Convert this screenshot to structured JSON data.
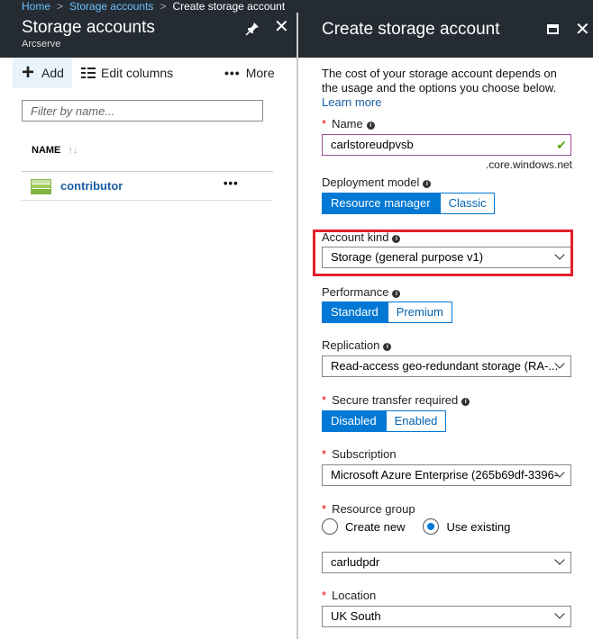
{
  "breadcrumb": {
    "items": [
      "Home",
      "Storage accounts"
    ],
    "current": "Create storage account"
  },
  "left_blade": {
    "title": "Storage accounts",
    "subtitle": "Arcserve",
    "toolbar": {
      "add": "Add",
      "edit_columns": "Edit columns",
      "more": "More"
    },
    "filter_placeholder": "Filter by name...",
    "column_name": "NAME",
    "rows": [
      {
        "name": "contributor"
      }
    ]
  },
  "right_blade": {
    "title": "Create storage account",
    "intro": "The cost of your storage account depends on the usage and the options you choose below.",
    "learn_more": "Learn more",
    "name": {
      "label": "Name",
      "value": "carlstoreudpvsb",
      "suffix": ".core.windows.net"
    },
    "deployment_model": {
      "label": "Deployment model",
      "options": [
        "Resource manager",
        "Classic"
      ],
      "selected": "Resource manager"
    },
    "account_kind": {
      "label": "Account kind",
      "value": "Storage (general purpose v1)"
    },
    "performance": {
      "label": "Performance",
      "options": [
        "Standard",
        "Premium"
      ],
      "selected": "Standard"
    },
    "replication": {
      "label": "Replication",
      "value": "Read-access geo-redundant storage (RA-..."
    },
    "secure_transfer": {
      "label": "Secure transfer required",
      "options": [
        "Disabled",
        "Enabled"
      ],
      "selected": "Disabled"
    },
    "subscription": {
      "label": "Subscription",
      "value": "Microsoft Azure Enterprise (265b69df-3396-"
    },
    "resource_group": {
      "label": "Resource group",
      "options": [
        "Create new",
        "Use existing"
      ],
      "selected": "Use existing",
      "value": "carludpdr"
    },
    "location": {
      "label": "Location",
      "value": "UK South"
    }
  },
  "colors": {
    "header_bg": "#252b32",
    "accent": "#0078d4",
    "highlight": "#e3202c",
    "link": "#1a5fa5"
  }
}
